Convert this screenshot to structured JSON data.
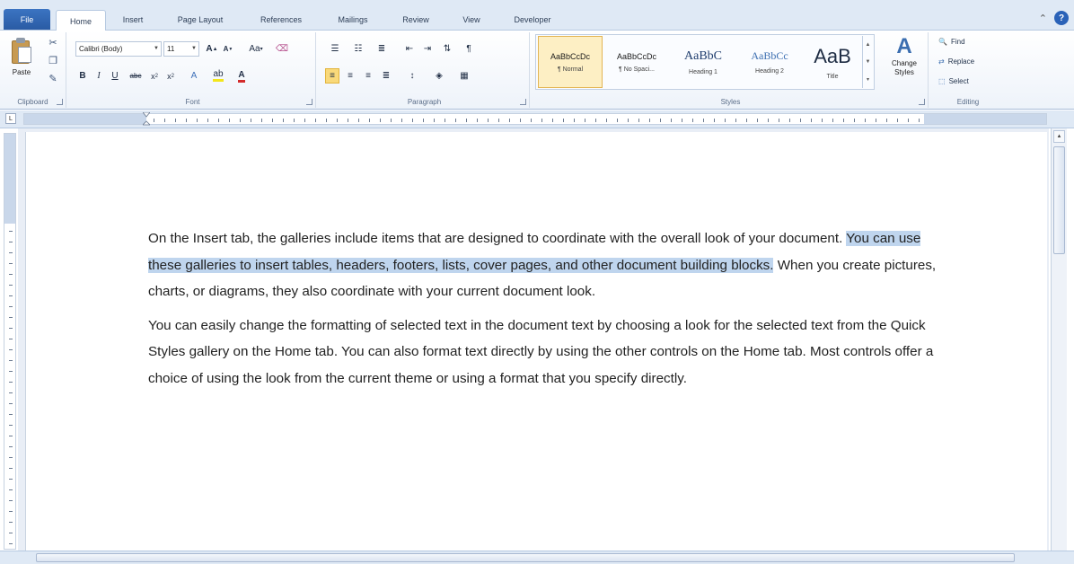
{
  "tabs": {
    "file": "File",
    "items": [
      "Home",
      "Insert",
      "Page Layout",
      "References",
      "Mailings",
      "Review",
      "View",
      "Developer"
    ],
    "active": "Home"
  },
  "ribbon": {
    "clipboard": {
      "paste_label": "Paste",
      "group_label": "Clipboard"
    },
    "font": {
      "font_name": "Calibri (Body)",
      "font_size": "11",
      "group_label": "Font"
    },
    "paragraph": {
      "group_label": "Paragraph"
    },
    "styles": {
      "group_label": "Styles",
      "items": [
        {
          "sample": "AaBbCcDc",
          "name": "¶ Normal"
        },
        {
          "sample": "AaBbCcDc",
          "name": "¶ No Spaci..."
        },
        {
          "sample": "AaBbC",
          "name": "Heading 1"
        },
        {
          "sample": "AaBbCc",
          "name": "Heading 2"
        },
        {
          "sample": "AaB",
          "name": "Title"
        }
      ],
      "change_styles_label": "Change Styles"
    },
    "editing": {
      "group_label": "Editing",
      "find": "Find",
      "replace": "Replace",
      "select": "Select"
    }
  },
  "document": {
    "p1_before": "On the Insert tab, the galleries include items that are designed to coordinate with the overall look of your document.",
    "p1_highlight": "You can use these galleries to insert tables, headers, footers, lists, cover pages, and other document building blocks.",
    "p1_after": "When you create pictures, charts, or diagrams, they also coordinate with your current document look.",
    "p2": "You can easily change the formatting of selected text in the document text by choosing a look for the selected text from the Quick Styles gallery on the Home tab. You can also format text directly by using the other controls on the Home tab. Most controls offer a choice of using the look from the current theme or using a format that you specify directly."
  },
  "colors": {
    "selection_highlight": "#bfd5ee",
    "file_tab": "#2a5ba4",
    "ribbon_bg": "#dfe9f5"
  }
}
